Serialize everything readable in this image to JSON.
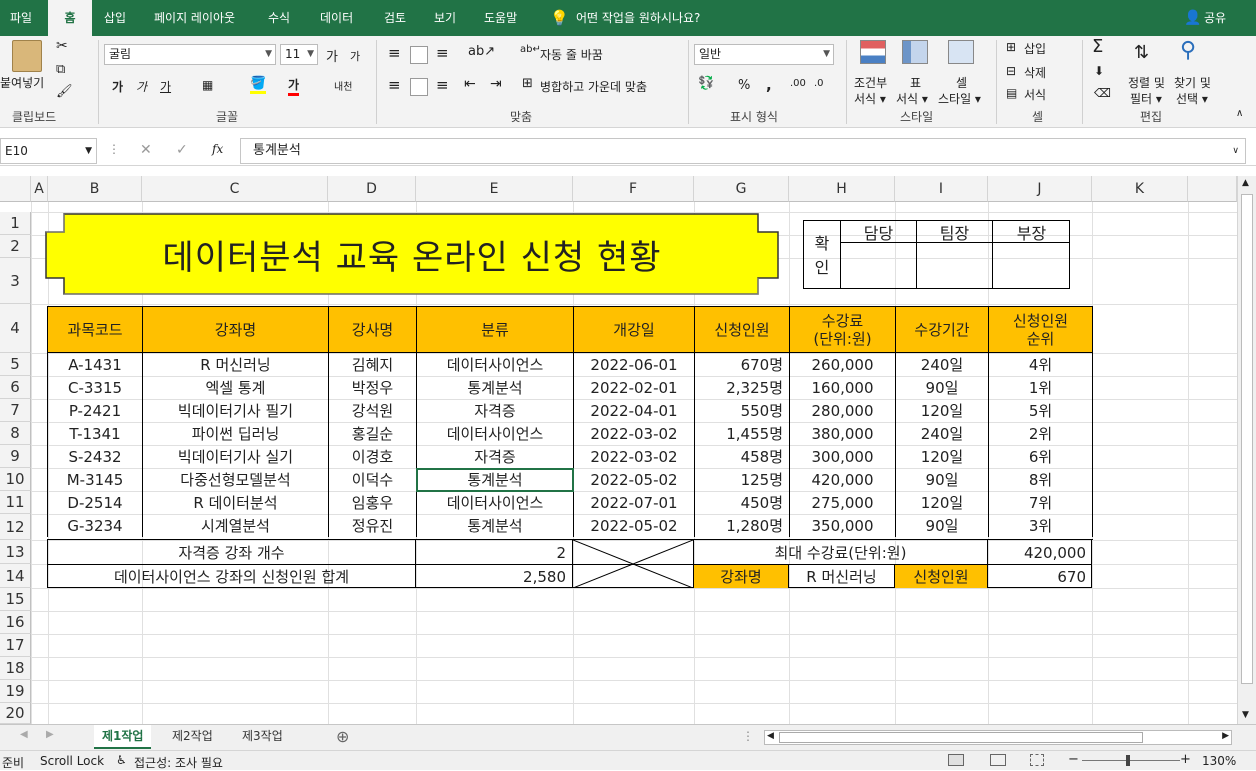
{
  "ribbon_tabs": [
    "파일",
    "홈",
    "삽입",
    "페이지 레이아웃",
    "수식",
    "데이터",
    "검토",
    "보기",
    "도움말"
  ],
  "tell_me": "어떤 작업을 원하시나요?",
  "share": "공유",
  "ribbon": {
    "clipboard": {
      "paste": "붙여넣기",
      "label": "클립보드"
    },
    "font": {
      "name": "굴림",
      "size": "11",
      "label": "글꼴",
      "grow": "가",
      "shrink": "가",
      "bold": "가",
      "italic": "가",
      "underline": "가",
      "fill_letter": "가",
      "phonetic": "내천"
    },
    "align": {
      "wrap": "자동 줄 바꿈",
      "merge": "병합하고 가운데 맞춤",
      "label": "맞춤"
    },
    "number": {
      "format": "일반",
      "label": "표시 형식",
      "percent": "%",
      "comma": ","
    },
    "styles": {
      "cond1": "조건부",
      "cond2": "서식 ▾",
      "table1": "표",
      "table2": "서식 ▾",
      "cell1": "셀",
      "cell2": "스타일 ▾",
      "label": "스타일"
    },
    "cells": {
      "insert": "삽입",
      "delete": "삭제",
      "format": "서식",
      "label": "셀"
    },
    "editing": {
      "sort1": "정렬 및",
      "sort2": "필터 ▾",
      "find1": "찾기 및",
      "find2": "선택 ▾",
      "label": "편집",
      "sigma": "Σ"
    }
  },
  "formula_bar": {
    "name_box": "E10",
    "formula": "통계분석",
    "fx": "fx"
  },
  "columns": [
    "A",
    "B",
    "C",
    "D",
    "E",
    "F",
    "G",
    "H",
    "I",
    "J",
    "K"
  ],
  "rows": [
    "1",
    "2",
    "3",
    "4",
    "5",
    "6",
    "7",
    "8",
    "9",
    "10",
    "11",
    "12",
    "13",
    "14",
    "15",
    "16",
    "17",
    "18",
    "19",
    "20"
  ],
  "title": "데이터분석 교육 온라인 신청 현황",
  "approval": {
    "label1": "확",
    "label2": "인",
    "cols": [
      "담당",
      "팀장",
      "부장"
    ]
  },
  "table": {
    "headers": [
      "과목코드",
      "강좌명",
      "강사명",
      "분류",
      "개강일",
      "신청인원",
      "수강료\n(단위:원)",
      "수강기간",
      "신청인원\n순위"
    ],
    "rows": [
      [
        "A-1431",
        "R 머신러닝",
        "김혜지",
        "데이터사이언스",
        "2022-06-01",
        "670명",
        "260,000",
        "240일",
        "4위"
      ],
      [
        "C-3315",
        "엑셀 통계",
        "박정우",
        "통계분석",
        "2022-02-01",
        "2,325명",
        "160,000",
        "90일",
        "1위"
      ],
      [
        "P-2421",
        "빅데이터기사 필기",
        "강석원",
        "자격증",
        "2022-04-01",
        "550명",
        "280,000",
        "120일",
        "5위"
      ],
      [
        "T-1341",
        "파이썬 딥러닝",
        "홍길순",
        "데이터사이언스",
        "2022-03-02",
        "1,455명",
        "380,000",
        "240일",
        "2위"
      ],
      [
        "S-2432",
        "빅데이터기사 실기",
        "이경호",
        "자격증",
        "2022-03-02",
        "458명",
        "300,000",
        "120일",
        "6위"
      ],
      [
        "M-3145",
        "다중선형모델분석",
        "이덕수",
        "통계분석",
        "2022-05-02",
        "125명",
        "420,000",
        "90일",
        "8위"
      ],
      [
        "D-2514",
        "R 데이터분석",
        "임홍우",
        "데이터사이언스",
        "2022-07-01",
        "450명",
        "275,000",
        "120일",
        "7위"
      ],
      [
        "G-3234",
        "시계열분석",
        "정유진",
        "통계분석",
        "2022-05-02",
        "1,280명",
        "350,000",
        "90일",
        "3위"
      ]
    ]
  },
  "summary": {
    "r13_label": "자격증 강좌 개수",
    "r13_value": "2",
    "r14_label": "데이터사이언스 강좌의 신청인원 합계",
    "r14_value": "2,580",
    "max_label": "최대 수강료(단위:원)",
    "max_value": "420,000",
    "course_label": "강좌명",
    "course_value": "R 머신러닝",
    "apply_label": "신청인원",
    "apply_value": "670"
  },
  "sheets": [
    "제1작업",
    "제2작업",
    "제3작업"
  ],
  "status": {
    "ready": "준비",
    "scroll_lock": "Scroll Lock",
    "accessibility": "접근성: 조사 필요",
    "zoom": "130%"
  },
  "colors": {
    "accent": "#217346",
    "header_fill": "#ffc000",
    "title_fill": "#ffff00"
  }
}
